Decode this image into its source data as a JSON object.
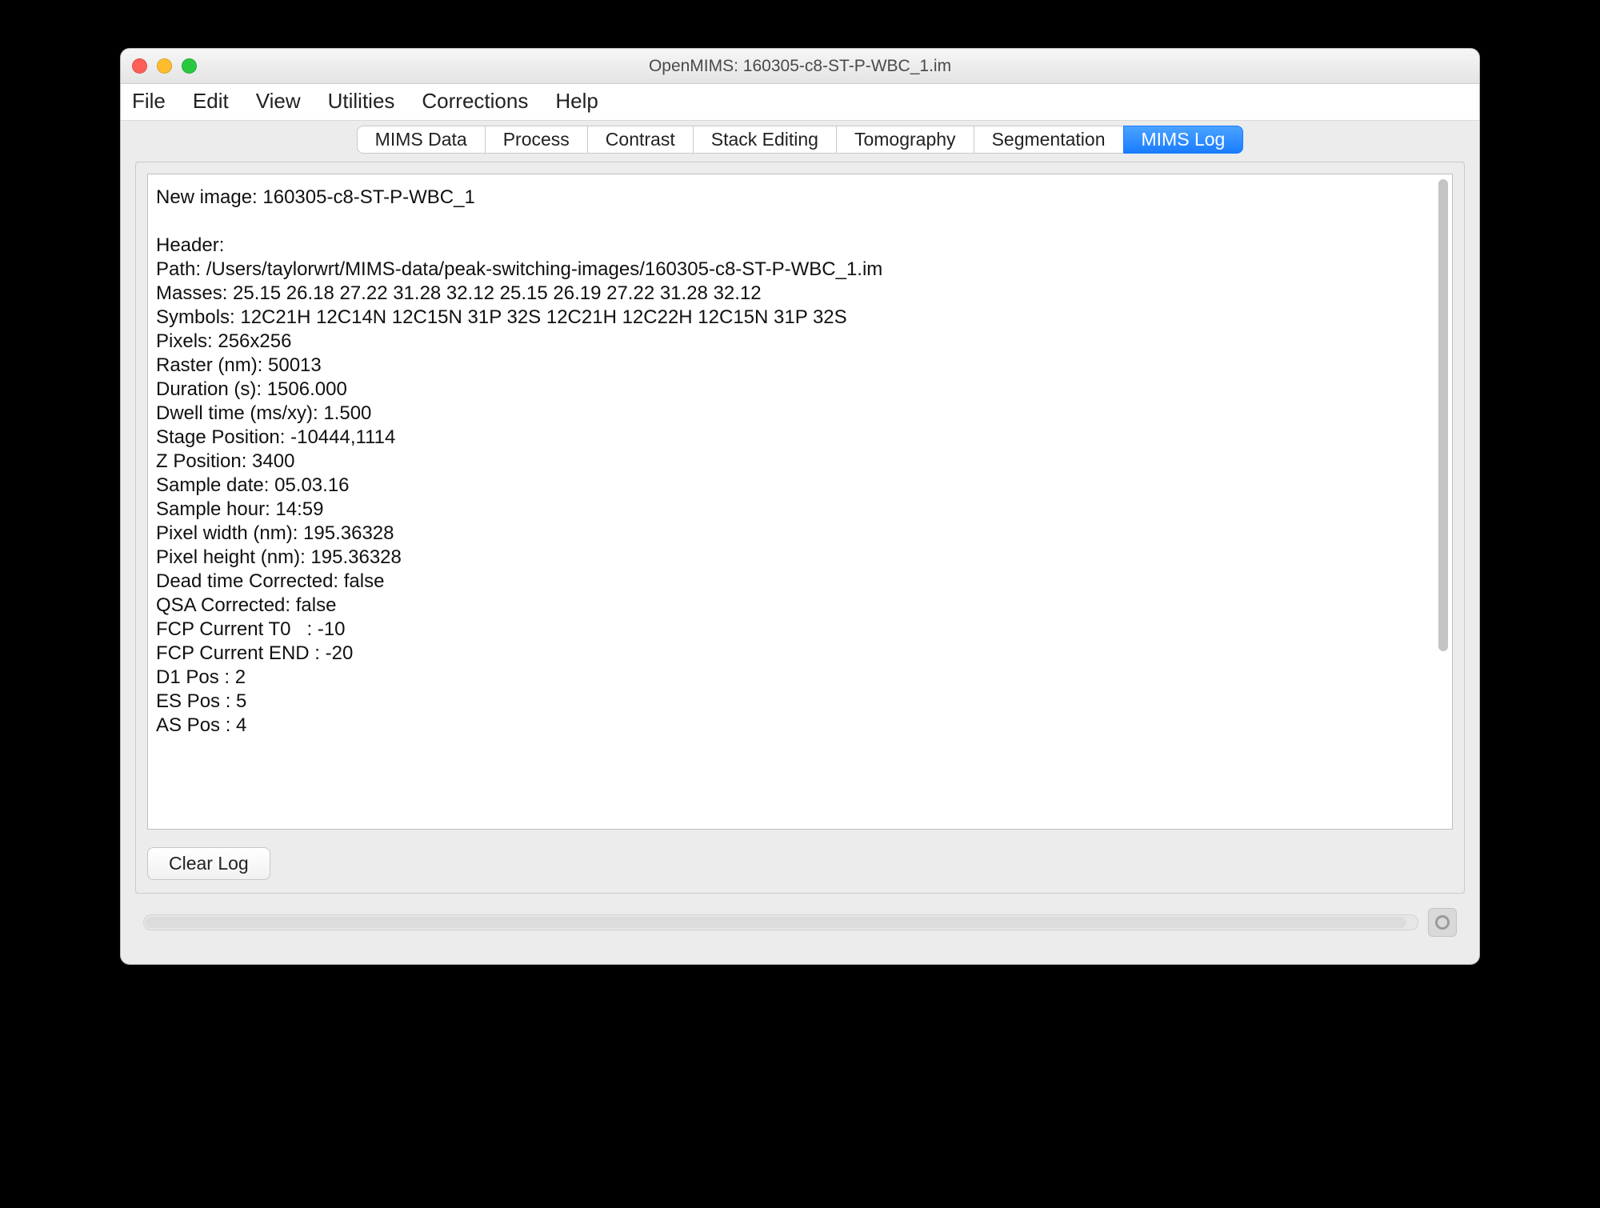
{
  "window": {
    "title": "OpenMIMS: 160305-c8-ST-P-WBC_1.im"
  },
  "menu": {
    "file": "File",
    "edit": "Edit",
    "view": "View",
    "utilities": "Utilities",
    "corrections": "Corrections",
    "help": "Help"
  },
  "tabs": {
    "mims_data": "MIMS Data",
    "process": "Process",
    "contrast": "Contrast",
    "stack_editing": "Stack Editing",
    "tomography": "Tomography",
    "segmentation": "Segmentation",
    "mims_log": "MIMS Log",
    "active": "mims_log"
  },
  "log_text": "New image: 160305-c8-ST-P-WBC_1\n\nHeader:\nPath: /Users/taylorwrt/MIMS-data/peak-switching-images/160305-c8-ST-P-WBC_1.im\nMasses: 25.15 26.18 27.22 31.28 32.12 25.15 26.19 27.22 31.28 32.12\nSymbols: 12C21H 12C14N 12C15N 31P 32S 12C21H 12C22H 12C15N 31P 32S\nPixels: 256x256\nRaster (nm): 50013\nDuration (s): 1506.000\nDwell time (ms/xy): 1.500\nStage Position: -10444,1114\nZ Position: 3400\nSample date: 05.03.16\nSample hour: 14:59\nPixel width (nm): 195.36328\nPixel height (nm): 195.36328\nDead time Corrected: false\nQSA Corrected: false\nFCP Current T0   : -10\nFCP Current END : -20\nD1 Pos : 2\nES Pos : 5\nAS Pos : 4",
  "buttons": {
    "clear_log": "Clear Log"
  }
}
